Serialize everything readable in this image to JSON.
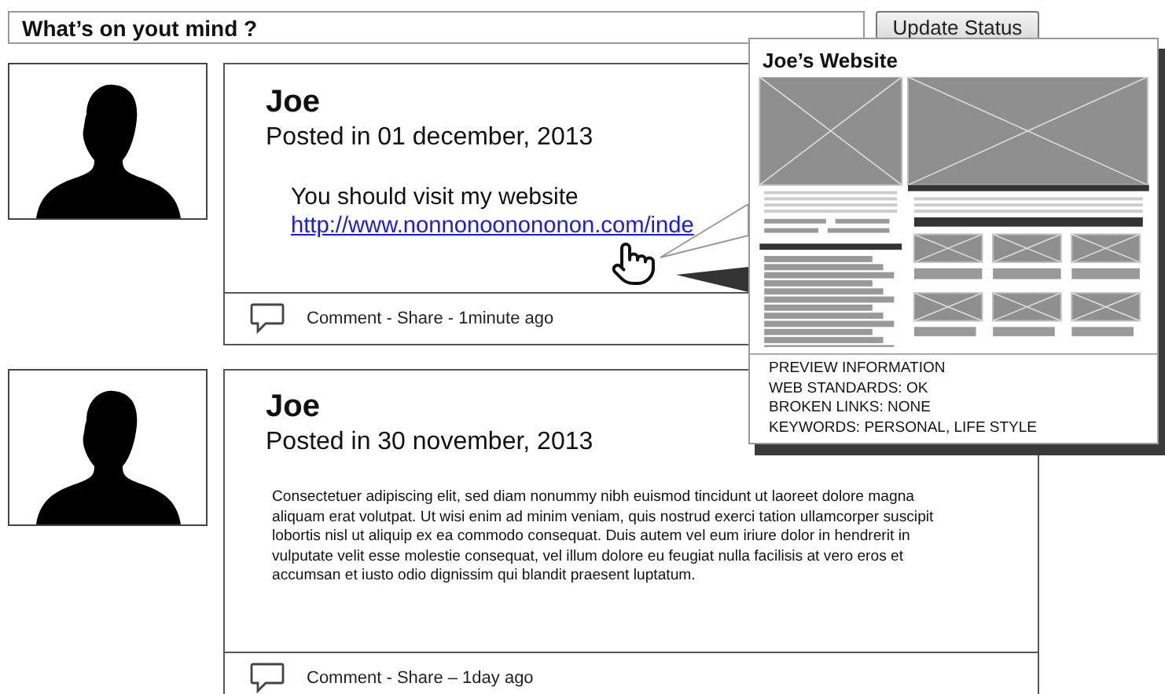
{
  "status": {
    "placeholder": "What’s on yout mind ?"
  },
  "update_button": "Update Status",
  "posts": [
    {
      "kind": "link",
      "author": "Joe",
      "posted": "Posted in 01 december, 2013",
      "message": "You should visit my website",
      "link": "http://www.nonnonoonononon.com/inde",
      "footer": "Comment - Share - 1minute ago"
    },
    {
      "kind": "text",
      "author": "Joe",
      "posted": "Posted in 30 november, 2013",
      "body": "Consectetuer adipiscing elit, sed diam nonummy nibh euismod tincidunt ut laoreet dolore magna aliquam erat volutpat. Ut wisi enim ad minim veniam, quis nostrud exerci tation ullamcorper suscipit lobortis nisl ut aliquip ex ea commodo consequat. Duis autem vel eum iriure dolor in hendrerit in vulputate velit esse molestie consequat, vel illum dolore eu feugiat nulla facilisis at vero eros et accumsan et iusto odio dignissim qui blandit praesent luptatum.",
      "footer": "Comment - Share – 1day ago"
    }
  ],
  "preview": {
    "title": "Joe’s Website",
    "info": [
      "PREVIEW INFORMATION",
      "WEB STANDARDS: OK",
      "BROKEN LINKS: NONE",
      "KEYWORDS: PERSONAL, LIFE STYLE"
    ]
  }
}
